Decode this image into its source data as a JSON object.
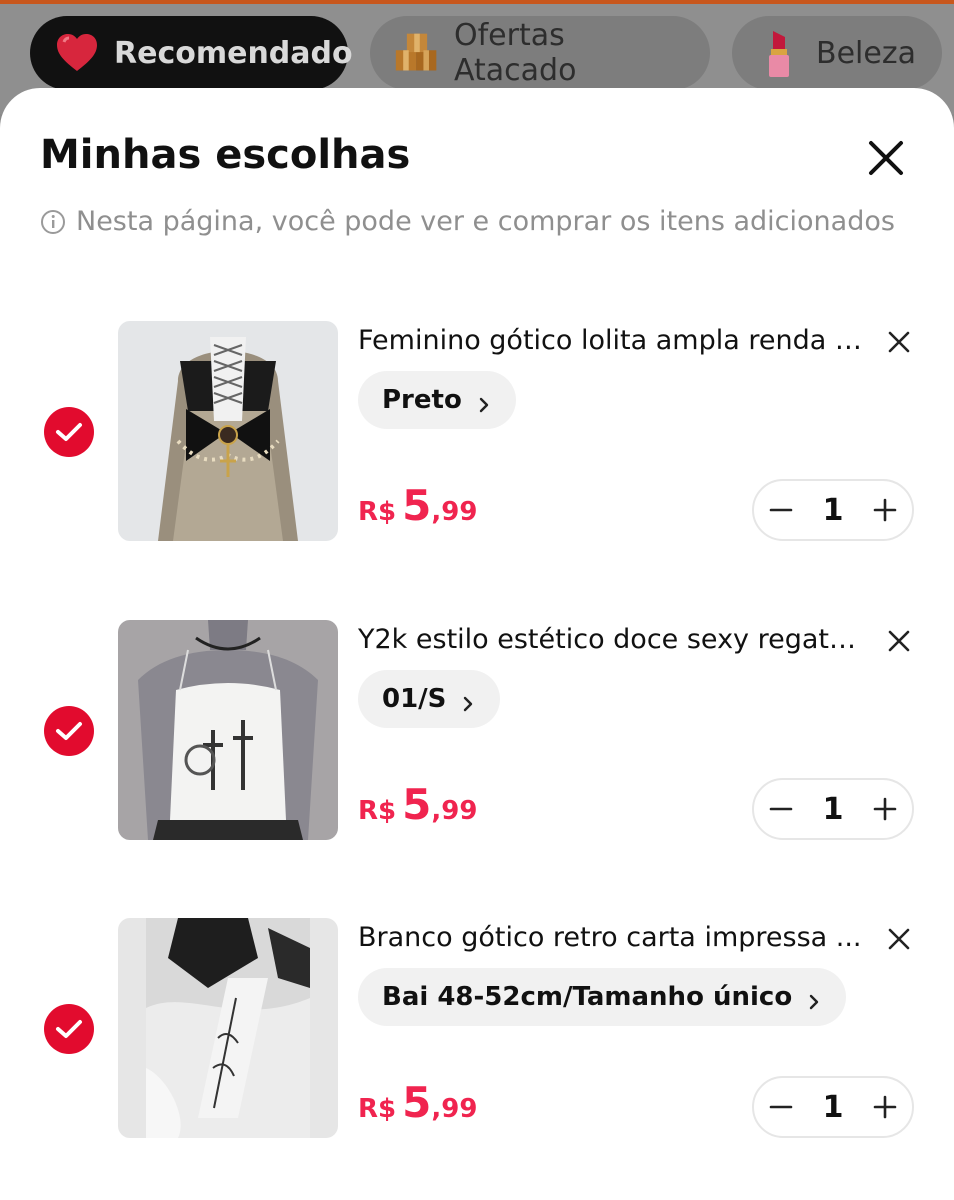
{
  "tabs": [
    {
      "label": "Recomendado",
      "icon": "heart-icon",
      "active": true
    },
    {
      "label": "Ofertas Atacado",
      "icon": "boxes-icon",
      "active": false
    },
    {
      "label": "Beleza",
      "icon": "lipstick-icon",
      "active": false
    }
  ],
  "sheet": {
    "title": "Minhas escolhas",
    "info": "Nesta página, você pode ver e comprar os itens adicionados"
  },
  "items": [
    {
      "name": "Feminino gótico lolita ampla renda c...",
      "variant": "Preto",
      "currency": "R$",
      "price_int": "5",
      "price_dec": ",99",
      "qty": "1",
      "checked": true
    },
    {
      "name": "Y2k estilo estético doce sexy regata ...",
      "variant": "01/S",
      "currency": "R$",
      "price_int": "5",
      "price_dec": ",99",
      "qty": "1",
      "checked": true
    },
    {
      "name": "Branco gótico retro carta impressa ...",
      "variant": "Bai 48-52cm/Tamanho único",
      "currency": "R$",
      "price_int": "5",
      "price_dec": ",99",
      "qty": "1",
      "checked": true
    }
  ],
  "colors": {
    "accent": "#f0244f",
    "check": "#e20b2e",
    "top_line": "#c8571d"
  }
}
